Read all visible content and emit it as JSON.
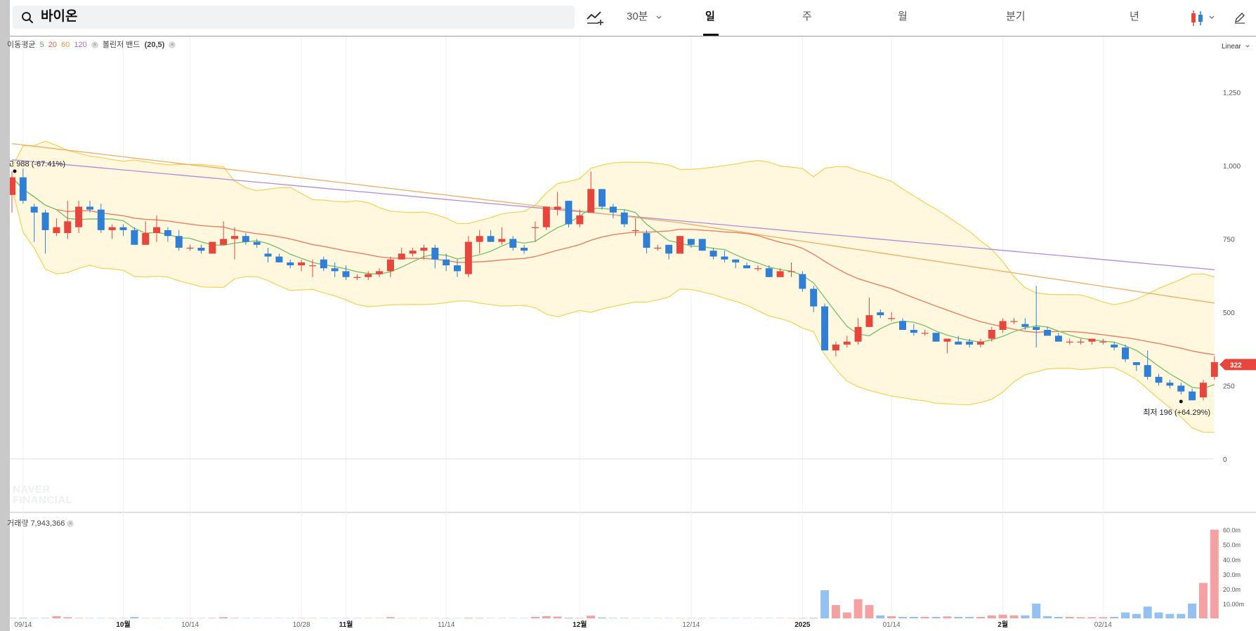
{
  "search": {
    "stock_name": "바이온"
  },
  "toolbar": {
    "minute_label": "30분",
    "tabs": [
      "일",
      "주",
      "월",
      "분기",
      "년"
    ],
    "active_tab": "일"
  },
  "indicators": {
    "ma_label": "이동평균",
    "ma_periods": [
      "5",
      "20",
      "60",
      "120"
    ],
    "bollinger_label": "볼린저 밴드",
    "bollinger_params": "(20,5)",
    "volume_label": "거래량",
    "volume_value": "7,943,366"
  },
  "scale": {
    "label": "Linear"
  },
  "watermark": {
    "line1": "NAVER",
    "line2": "FINANCIAL"
  },
  "colors": {
    "up": "#e8453c",
    "down": "#2f7fd6",
    "ma5": "#7cc36e",
    "ma20": "#ec8060",
    "ma60": "#f0ad60",
    "ma120": "#b58ad8",
    "band_line": "#f5d45a",
    "band_fill": "#fff8df",
    "vol_up": "#f5a1a1",
    "vol_down": "#93c1f2",
    "price_tag": "#e8453c"
  },
  "chart_data": {
    "type": "candlestick",
    "ylim": [
      -60,
      1440
    ],
    "y_ticks": [
      0,
      250,
      500,
      750,
      "1,000",
      "1,250"
    ],
    "y_tick_values": [
      0,
      250,
      500,
      750,
      1000,
      1250
    ],
    "x_tick_labels": [
      {
        "label": "09/14",
        "index": 1,
        "bold": false
      },
      {
        "label": "10월",
        "index": 10,
        "bold": true
      },
      {
        "label": "10/14",
        "index": 16,
        "bold": false
      },
      {
        "label": "10/28",
        "index": 26,
        "bold": false
      },
      {
        "label": "11월",
        "index": 30,
        "bold": true
      },
      {
        "label": "11/14",
        "index": 39,
        "bold": false
      },
      {
        "label": "12월",
        "index": 51,
        "bold": true
      },
      {
        "label": "12/14",
        "index": 61,
        "bold": false
      },
      {
        "label": "2025",
        "index": 71,
        "bold": true
      },
      {
        "label": "01/14",
        "index": 79,
        "bold": false
      },
      {
        "label": "2월",
        "index": 89,
        "bold": true
      },
      {
        "label": "02/14",
        "index": 98,
        "bold": false
      }
    ],
    "candles": [
      [
        900,
        980,
        840,
        960
      ],
      [
        960,
        990,
        870,
        880
      ],
      [
        860,
        870,
        740,
        840
      ],
      [
        840,
        850,
        700,
        780
      ],
      [
        770,
        820,
        760,
        790
      ],
      [
        770,
        880,
        750,
        810
      ],
      [
        790,
        880,
        770,
        860
      ],
      [
        860,
        880,
        840,
        850
      ],
      [
        850,
        870,
        770,
        780
      ],
      [
        780,
        800,
        750,
        790
      ],
      [
        790,
        800,
        760,
        780
      ],
      [
        780,
        790,
        730,
        730
      ],
      [
        730,
        810,
        730,
        770
      ],
      [
        770,
        830,
        740,
        790
      ],
      [
        780,
        790,
        740,
        760
      ],
      [
        760,
        780,
        710,
        720
      ],
      [
        720,
        730,
        710,
        720
      ],
      [
        720,
        730,
        700,
        710
      ],
      [
        700,
        740,
        700,
        740
      ],
      [
        730,
        810,
        730,
        750
      ],
      [
        750,
        790,
        680,
        760
      ],
      [
        760,
        770,
        730,
        740
      ],
      [
        740,
        750,
        720,
        730
      ],
      [
        700,
        720,
        670,
        690
      ],
      [
        690,
        700,
        670,
        670
      ],
      [
        670,
        680,
        650,
        660
      ],
      [
        660,
        680,
        640,
        670
      ],
      [
        660,
        680,
        620,
        660
      ],
      [
        680,
        690,
        640,
        650
      ],
      [
        650,
        670,
        620,
        640
      ],
      [
        640,
        660,
        610,
        620
      ],
      [
        620,
        630,
        610,
        620
      ],
      [
        620,
        640,
        610,
        630
      ],
      [
        630,
        650,
        620,
        640
      ],
      [
        640,
        690,
        620,
        680
      ],
      [
        680,
        720,
        680,
        700
      ],
      [
        700,
        720,
        690,
        710
      ],
      [
        710,
        730,
        680,
        720
      ],
      [
        720,
        730,
        650,
        680
      ],
      [
        680,
        700,
        640,
        660
      ],
      [
        660,
        680,
        620,
        640
      ],
      [
        630,
        760,
        620,
        740
      ],
      [
        740,
        780,
        700,
        760
      ],
      [
        760,
        780,
        740,
        740
      ],
      [
        740,
        790,
        730,
        750
      ],
      [
        750,
        760,
        710,
        720
      ],
      [
        720,
        730,
        700,
        710
      ],
      [
        790,
        810,
        740,
        790
      ],
      [
        790,
        860,
        780,
        860
      ],
      [
        850,
        910,
        830,
        860
      ],
      [
        880,
        880,
        790,
        800
      ],
      [
        800,
        850,
        790,
        830
      ],
      [
        840,
        980,
        840,
        920
      ],
      [
        920,
        920,
        850,
        860
      ],
      [
        860,
        870,
        820,
        840
      ],
      [
        840,
        850,
        790,
        800
      ],
      [
        780,
        820,
        760,
        780
      ],
      [
        770,
        780,
        700,
        720
      ],
      [
        720,
        730,
        710,
        720
      ],
      [
        730,
        730,
        680,
        700
      ],
      [
        700,
        760,
        700,
        760
      ],
      [
        750,
        750,
        720,
        730
      ],
      [
        750,
        750,
        710,
        710
      ],
      [
        710,
        720,
        680,
        690
      ],
      [
        690,
        710,
        670,
        680
      ],
      [
        680,
        680,
        650,
        670
      ],
      [
        660,
        670,
        650,
        650
      ],
      [
        650,
        660,
        640,
        650
      ],
      [
        650,
        660,
        620,
        620
      ],
      [
        620,
        650,
        620,
        640
      ],
      [
        640,
        670,
        620,
        640
      ],
      [
        630,
        640,
        570,
        580
      ],
      [
        580,
        590,
        500,
        520
      ],
      [
        520,
        530,
        370,
        370
      ],
      [
        370,
        400,
        350,
        390
      ],
      [
        390,
        420,
        380,
        400
      ],
      [
        400,
        480,
        390,
        450
      ],
      [
        450,
        550,
        450,
        490
      ],
      [
        500,
        510,
        480,
        490
      ],
      [
        480,
        500,
        470,
        480
      ],
      [
        470,
        480,
        440,
        440
      ],
      [
        440,
        460,
        420,
        430
      ],
      [
        430,
        440,
        420,
        430
      ],
      [
        430,
        430,
        400,
        400
      ],
      [
        400,
        410,
        360,
        410
      ],
      [
        400,
        420,
        390,
        390
      ],
      [
        400,
        410,
        380,
        390
      ],
      [
        390,
        410,
        380,
        400
      ],
      [
        410,
        450,
        400,
        440
      ],
      [
        440,
        480,
        430,
        470
      ],
      [
        470,
        480,
        460,
        470
      ],
      [
        460,
        480,
        440,
        450
      ],
      [
        450,
        590,
        380,
        440
      ],
      [
        440,
        450,
        420,
        420
      ],
      [
        420,
        430,
        400,
        400
      ],
      [
        400,
        410,
        390,
        400
      ],
      [
        400,
        410,
        390,
        400
      ],
      [
        400,
        410,
        390,
        410
      ],
      [
        400,
        410,
        390,
        400
      ],
      [
        390,
        400,
        370,
        380
      ],
      [
        380,
        390,
        330,
        340
      ],
      [
        330,
        330,
        300,
        320
      ],
      [
        320,
        370,
        270,
        280
      ],
      [
        280,
        290,
        250,
        260
      ],
      [
        260,
        270,
        240,
        250
      ],
      [
        250,
        260,
        220,
        230
      ],
      [
        230,
        240,
        200,
        200
      ],
      [
        210,
        270,
        200,
        260
      ],
      [
        280,
        350,
        270,
        330
      ]
    ],
    "volume_m": [
      0.3,
      0.4,
      0.2,
      0.3,
      1.5,
      0.8,
      0.3,
      0.2,
      0.2,
      0.2,
      0.2,
      0.9,
      0.2,
      0.2,
      0.2,
      0.2,
      0.2,
      0.2,
      0.3,
      0.8,
      0.3,
      0.2,
      0.2,
      0.2,
      0.2,
      0.2,
      0.2,
      0.2,
      0.2,
      0.2,
      0.2,
      0.2,
      0.2,
      0.2,
      0.8,
      0.2,
      0.2,
      0.2,
      0.2,
      0.2,
      0.2,
      0.4,
      0.3,
      0.2,
      0.2,
      0.2,
      0.2,
      1.0,
      1.5,
      1.2,
      0.5,
      0.3,
      1.8,
      0.6,
      0.3,
      0.3,
      0.2,
      0.2,
      0.2,
      0.2,
      0.2,
      0.2,
      0.2,
      0.2,
      0.2,
      0.2,
      0.2,
      0.2,
      0.2,
      0.2,
      0.2,
      0.3,
      0.4,
      19.0,
      9.0,
      4.0,
      13.0,
      9.0,
      2.0,
      1.5,
      1.0,
      1.0,
      1.0,
      1.0,
      1.3,
      1.0,
      1.0,
      1.0,
      2.0,
      2.5,
      2.0,
      2.0,
      10.0,
      1.5,
      1.0,
      1.0,
      0.8,
      0.8,
      0.8,
      1.0,
      4.0,
      3.0,
      8.0,
      4.0,
      3.0,
      3.0,
      10.0,
      24.0,
      60.0
    ],
    "volume_ylim": [
      0,
      66
    ],
    "volume_ticks": [
      "10.00m",
      "20.0m",
      "30.0m",
      "40.0m",
      "50.0m",
      "60.0m"
    ],
    "volume_tick_values": [
      10,
      20,
      30,
      40,
      50,
      60
    ],
    "annotations": {
      "high": {
        "label": "최고",
        "value": "988",
        "pct": "(-67.41%)",
        "index": 0,
        "price": 988
      },
      "low": {
        "label": "최저",
        "value": "196",
        "pct": "(+64.29%)",
        "index": 105,
        "price": 196
      },
      "current": {
        "value": "322",
        "price": 322
      }
    }
  }
}
